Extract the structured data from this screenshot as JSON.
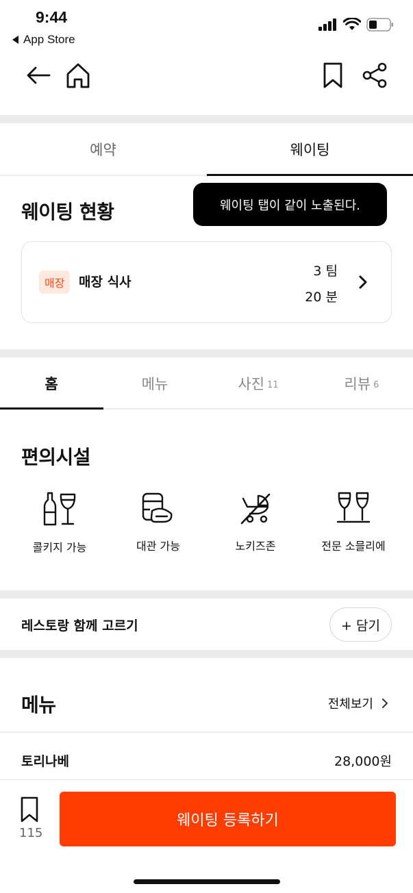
{
  "status_bar": {
    "time": "9:44",
    "back_app": "App Store"
  },
  "top_tabs": [
    {
      "label": "예약"
    },
    {
      "label": "웨이팅"
    }
  ],
  "waiting": {
    "title": "웨이팅 현황",
    "tooltip": "웨이팅 탭이 같이 노출된다.",
    "badge": "매장",
    "label": "매장 식사",
    "teams": "3 팀",
    "minutes": "20 분"
  },
  "sub_tabs": [
    {
      "label": "홈",
      "count": ""
    },
    {
      "label": "메뉴",
      "count": ""
    },
    {
      "label": "사진",
      "count": "11"
    },
    {
      "label": "리뷰",
      "count": "6"
    }
  ],
  "amenities": {
    "title": "편의시설",
    "items": [
      {
        "label": "콜키지 가능",
        "icon": "wine-bottle-glass-icon"
      },
      {
        "label": "대관 가능",
        "icon": "private-room-icon"
      },
      {
        "label": "노키즈존",
        "icon": "no-kids-icon"
      },
      {
        "label": "전문 소믈리에",
        "icon": "sommelier-icon"
      }
    ]
  },
  "compare": {
    "label": "레스토랑 함께 고르기",
    "button": "+ 담기"
  },
  "menu": {
    "title": "메뉴",
    "see_all": "전체보기",
    "items": [
      {
        "name": "토리나베",
        "price": "28,000원"
      }
    ]
  },
  "bottom": {
    "bookmark_count": "115",
    "cta": "웨이팅 등록하기"
  },
  "colors": {
    "accent": "#ff3d00",
    "badge_bg": "#fde9e0",
    "badge_text": "#ff4a1a"
  }
}
